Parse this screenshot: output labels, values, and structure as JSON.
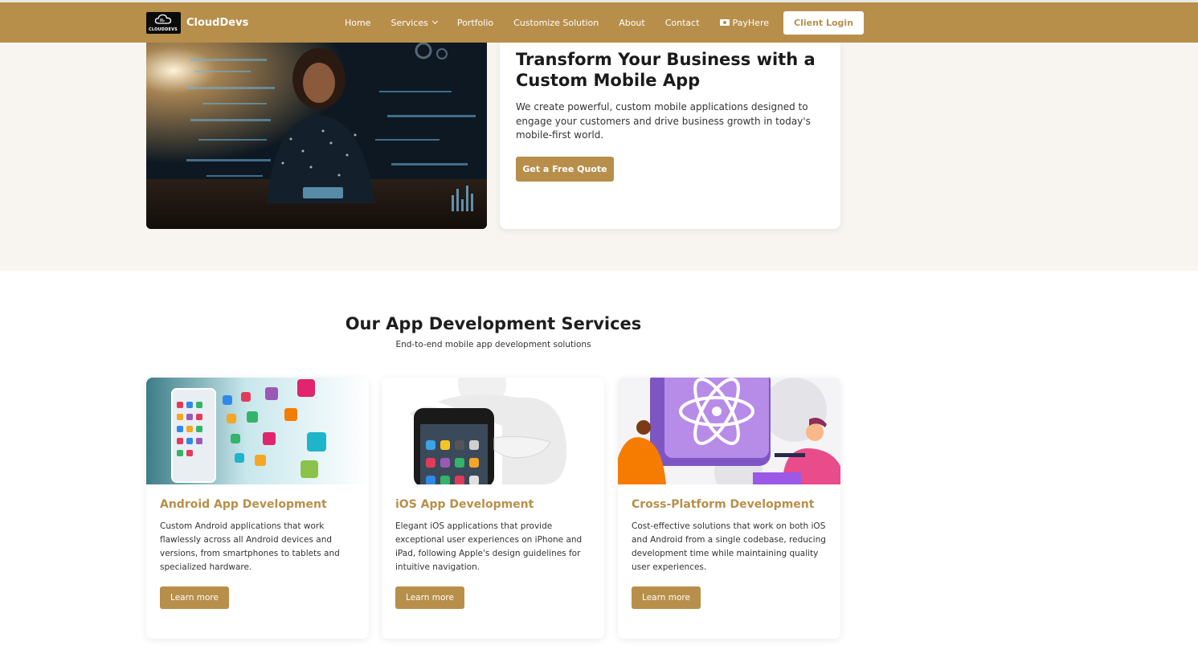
{
  "brand": {
    "name": "CloudDevs",
    "logo_text": "CLOUDDEVS"
  },
  "nav": {
    "items": [
      {
        "label": "Home"
      },
      {
        "label": "Services",
        "has_dropdown": true
      },
      {
        "label": "Portfolio"
      },
      {
        "label": "Customize Solution"
      },
      {
        "label": "About"
      },
      {
        "label": "Contact"
      },
      {
        "label": "PayHere",
        "icon": "money-icon"
      }
    ],
    "login_label": "Client Login"
  },
  "hero": {
    "title": "Transform Your Business with a Custom Mobile App",
    "description": "We create powerful, custom mobile applications designed to engage your customers and drive business growth in today's mobile-first world.",
    "cta_label": "Get a Free Quote",
    "image": "woman-with-tablet-data-visualization"
  },
  "services": {
    "title": "Our App Development Services",
    "subtitle": "End-to-end mobile app development solutions",
    "cards": [
      {
        "title": "Android App Development",
        "description": "Custom Android applications that work flawlessly across all Android devices and versions, from smartphones to tablets and specialized hardware.",
        "button_label": "Learn more",
        "image": "tablet-with-app-icons"
      },
      {
        "title": "iOS App Development",
        "description": "Elegant iOS applications that provide exceptional user experiences on iPhone and iPad, following Apple's design guidelines for intuitive navigation.",
        "button_label": "Learn more",
        "image": "3d-figure-with-iphone"
      },
      {
        "title": "Cross-Platform Development",
        "description": "Cost-effective solutions that work on both iOS and Android from a single codebase, reducing development time while maintaining quality user experiences.",
        "button_label": "Learn more",
        "image": "react-atom-illustration"
      }
    ]
  },
  "colors": {
    "accent": "#b78f4b",
    "hero_bg": "#f8f5f0",
    "nav_text": "#ffffff"
  }
}
